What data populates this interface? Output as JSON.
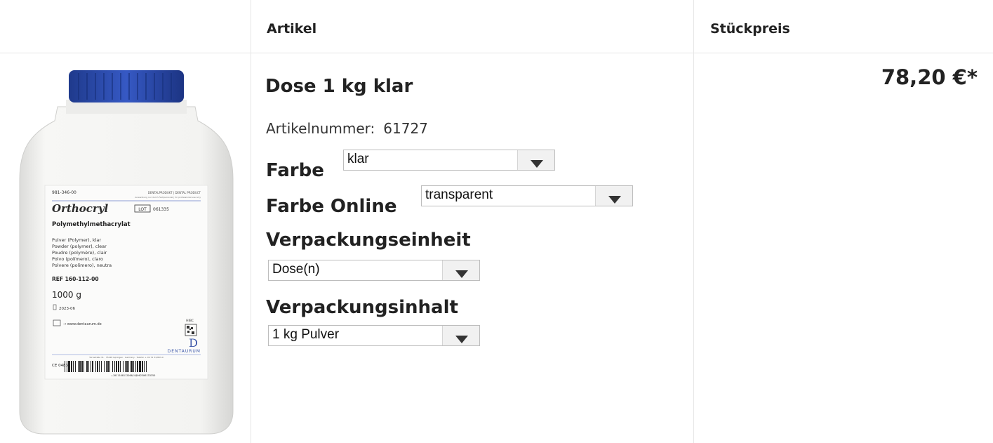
{
  "header": {
    "col_artikel": "Artikel",
    "col_price": "Stückpreis"
  },
  "product": {
    "name": "Dose 1 kg klar",
    "artno_label": "Artikelnummer:",
    "artno_value": "61727",
    "price": "78,20 €*",
    "image": {
      "label_code": "981-346-00",
      "label_top_right": "DENTALPRODUKT | DENTAL PRODUCT",
      "label_top_sub": "Anwendung nur durch Fachpersonal | for professional use only",
      "brand": "Orthocryl",
      "lot_label": "LOT",
      "lot_value": "061335",
      "product_title": "Polymethylmethacrylat",
      "desc_lines": [
        "Pulver (Polymer), klar",
        "Powder (polymer), clear",
        "Poudre (polymère), clair",
        "Polvo (polímero), claro",
        "Polvere (polimero), neutra"
      ],
      "ref": "REF 160-112-00",
      "weight": "1000 g",
      "date": "2023-06",
      "website": "→ www.dentaurum.de",
      "hibc": "HIBC",
      "maker": "DENTAURUM",
      "maker_line": "Turnstraße 31 · 75228 Ispringen · Germany · Telefon + 49 72 31/803-0",
      "ce": "CE 0483",
      "barcode_text": "+J011160112000/$$062306133355",
      "colors": {
        "cap": "#2f4fb0",
        "bottle": "#f4f4f2"
      }
    }
  },
  "options": {
    "farbe": {
      "label": "Farbe",
      "value": "klar"
    },
    "farbe_online": {
      "label": "Farbe Online",
      "value": "transparent"
    },
    "verpackungseinheit": {
      "label": "Verpackungseinheit",
      "value": "Dose(n)"
    },
    "verpackungsinhalt": {
      "label": "Verpackungsinhalt",
      "value": "1 kg Pulver"
    }
  }
}
